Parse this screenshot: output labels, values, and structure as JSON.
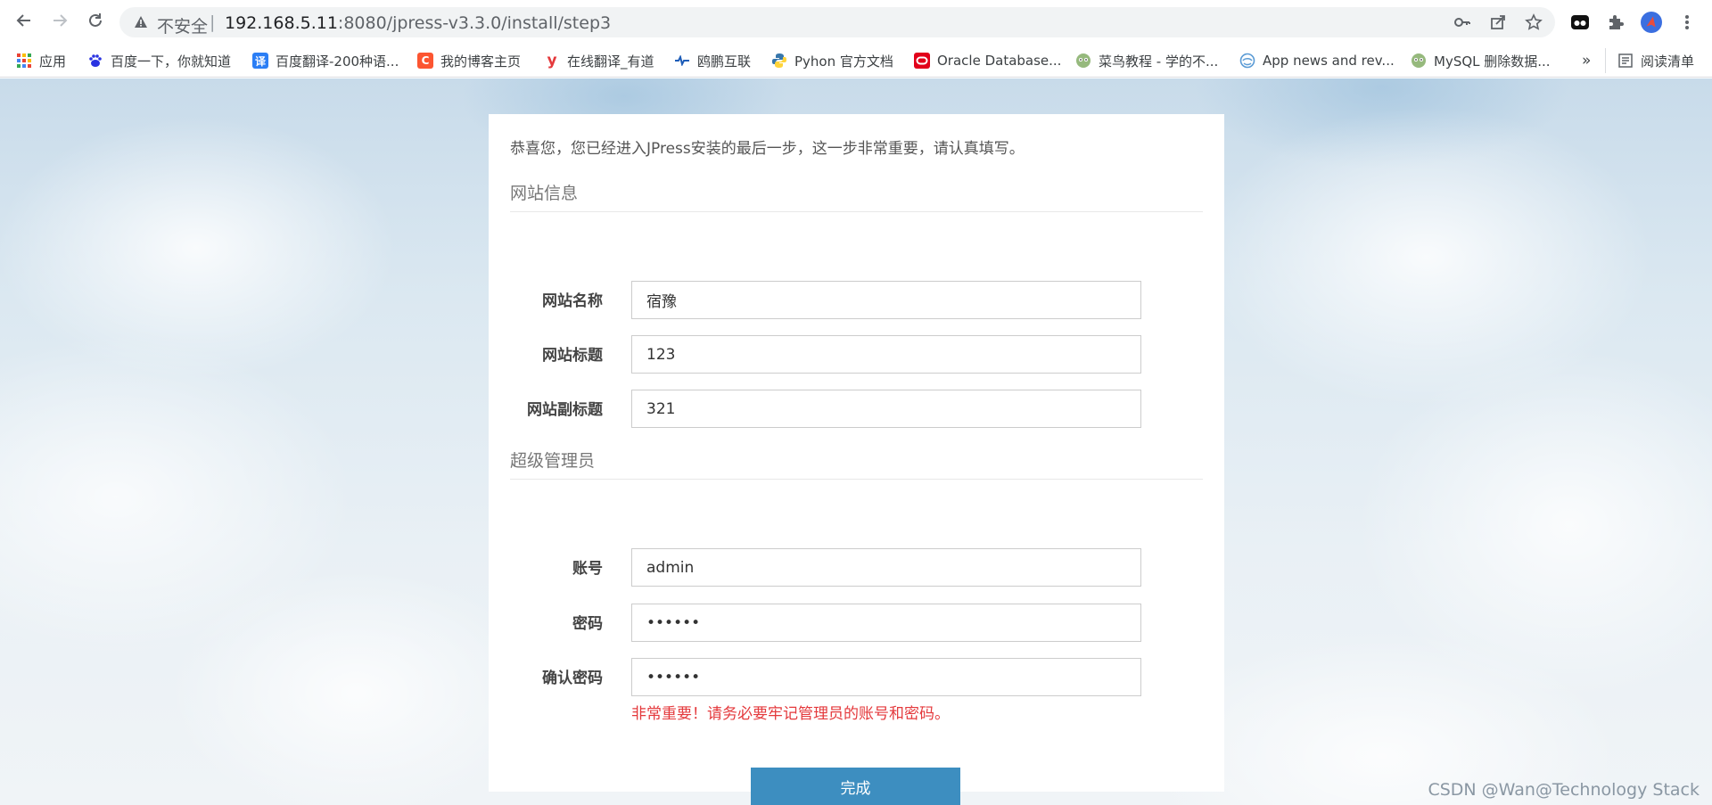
{
  "browser": {
    "insecure_label": "不安全",
    "separator": "|",
    "url_host": "192.168.5.11",
    "url_path": ":8080/jpress-v3.3.0/install/step3",
    "avatar_color": "#3b6fe0"
  },
  "bookmarks": {
    "items": [
      {
        "label": "应用",
        "icon": "apps-grid-icon"
      },
      {
        "label": "百度一下，你就知道",
        "icon": "baidu-icon"
      },
      {
        "label": "百度翻译-200种语...",
        "icon": "translate-icon",
        "glyph": "译"
      },
      {
        "label": "我的博客主页",
        "icon": "csdn-icon",
        "glyph": "C"
      },
      {
        "label": "在线翻译_有道",
        "icon": "youdao-icon",
        "glyph": "y"
      },
      {
        "label": "鸥鹏互联",
        "icon": "oupeng-icon"
      },
      {
        "label": "Pyhon 官方文档",
        "icon": "python-icon"
      },
      {
        "label": "Oracle Database...",
        "icon": "oracle-icon"
      },
      {
        "label": "菜鸟教程 - 学的不...",
        "icon": "runoob-icon"
      },
      {
        "label": "App news and rev...",
        "icon": "app-news-icon"
      },
      {
        "label": "MySQL 删除数据...",
        "icon": "runoob-icon"
      }
    ],
    "overflow": "»",
    "reading_list": "阅读清单"
  },
  "page": {
    "intro": "恭喜您，您已经进入JPress安装的最后一步，这一步非常重要，请认真填写。",
    "site_section": {
      "title": "网站信息",
      "fields": [
        {
          "label": "网站名称",
          "value": "宿豫"
        },
        {
          "label": "网站标题",
          "value": "123"
        },
        {
          "label": "网站副标题",
          "value": "321"
        }
      ]
    },
    "admin_section": {
      "title": "超级管理员",
      "fields": [
        {
          "label": "账号",
          "value": "admin"
        },
        {
          "label": "密码",
          "value": "••••••"
        },
        {
          "label": "确认密码",
          "value": "••••••"
        }
      ]
    },
    "warning": "非常重要！请务必要牢记管理员的账号和密码。",
    "submit_label": "完成",
    "accent_color": "#3d8ec0",
    "warning_color": "#e4393c"
  },
  "watermark": "CSDN @Wan@Technology Stack"
}
